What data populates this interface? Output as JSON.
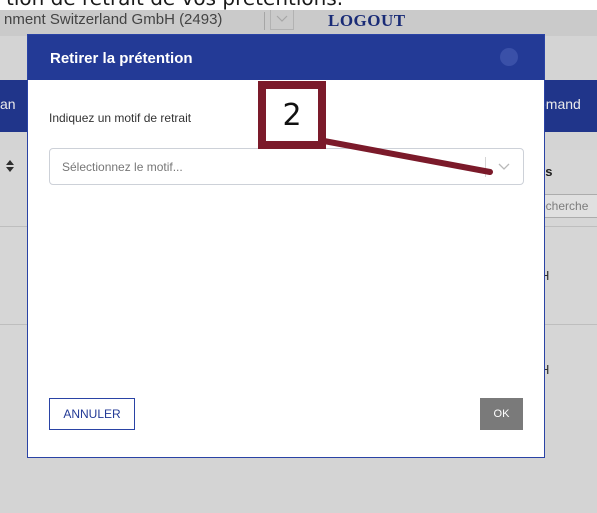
{
  "caption": {
    "text": "tion de retrait de vos prétentions."
  },
  "app": {
    "company": "nment Switzerland GmbH (2493)",
    "logout": "LOGOUT",
    "nav_left": "an",
    "nav_right": "emand",
    "table": {
      "col_right": "ys",
      "search_right_placeholder": "echerche",
      "row_cells": [
        "H",
        "H"
      ]
    }
  },
  "modal": {
    "title": "Retirer la prétention",
    "reason_label": "Indiquez un motif de retrait",
    "select_placeholder": "Sélectionnez le motif...",
    "cancel_label": "ANNULER",
    "ok_label": "OK"
  },
  "annotation": {
    "number": "2",
    "color": "#7b1a2a"
  },
  "colors": {
    "brand": "#233a96",
    "ok_button": "#7a7a7a"
  },
  "icons": {
    "sort": "sort-arrows-icon",
    "dropdown": "chevron-down-icon",
    "close": "close-icon"
  }
}
